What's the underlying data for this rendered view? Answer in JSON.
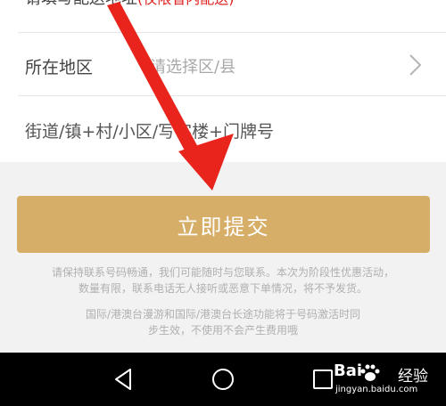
{
  "form": {
    "header_note": "请填写配送地址",
    "header_limit": "(仅限省内配送)",
    "region_label": "所在地区",
    "region_placeholder": "请选择区/县",
    "street_placeholder": "街道/镇+村/小区/写字楼+门牌号"
  },
  "submit_label": "立即提交",
  "notes": {
    "contact": [
      "请保持联系号码畅通，我们可能随时与您联系。本次为阶段性优惠活动，",
      "数量有限，联系电话无人接听或恶意下单情况，将不予发货。"
    ],
    "roaming": [
      "国际/港澳台漫游和国际/港澳台长途功能将于号码激活时同",
      "步生效，不使用不会产生费用哦"
    ]
  },
  "watermark": {
    "brand": "Bai",
    "brand_suffix": "经验",
    "url": "jingyan.baidu.com"
  },
  "colors": {
    "submit_bg": "#d6ae68",
    "limit_text": "#e02020",
    "annotation_arrow": "#e8241c"
  },
  "icons": {
    "region_chevron": "chevron-right-icon",
    "nav_back": "triangle-back-icon",
    "nav_home": "circle-home-icon",
    "nav_recent": "square-recent-icon",
    "annotation": "red-arrow-icon"
  }
}
